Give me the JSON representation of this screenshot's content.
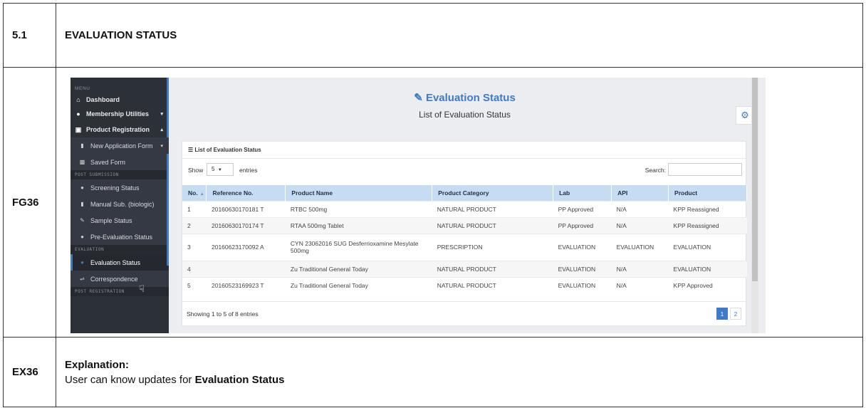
{
  "section": {
    "number": "5.1",
    "title": "EVALUATION STATUS"
  },
  "figure": {
    "label": "FG36"
  },
  "explanation": {
    "label": "EX36",
    "title": "Explanation:",
    "text_prefix": "User can know updates for ",
    "text_bold": "Evaluation Status"
  },
  "sidebar": {
    "menu_label": "MENU",
    "dashboard": "Dashboard",
    "membership": "Membership Utilities",
    "product_registration": "Product Registration",
    "new_application": "New Application Form",
    "saved_form": "Saved Form",
    "post_submission_label": "POST SUBMISSION",
    "screening": "Screening Status",
    "manual_sub": "Manual Sub. (biologic)",
    "sample": "Sample Status",
    "pre_evaluation": "Pre-Evaluation Status",
    "evaluation_label": "EVALUATION",
    "evaluation_status": "Evaluation Status",
    "correspondence": "Correspondence",
    "post_registration_label": "POST REGISTRATION"
  },
  "page": {
    "title": "Evaluation Status",
    "subtitle": "List of Evaluation Status"
  },
  "panel": {
    "heading": "List of Evaluation Status",
    "show_label": "Show",
    "entries_value": "5",
    "entries_label": "entries",
    "search_label": "Search:",
    "columns": [
      "No.",
      "Reference No.",
      "Product Name",
      "Product Category",
      "Lab",
      "API",
      "Product"
    ],
    "rows": [
      [
        "1",
        "20160630170181 T",
        "RTBC 500mg",
        "NATURAL PRODUCT",
        "PP Approved",
        "N/A",
        "KPP Reassigned"
      ],
      [
        "2",
        "20160630170174 T",
        "RTAA 500mg Tablet",
        "NATURAL PRODUCT",
        "PP Approved",
        "N/A",
        "KPP Reassigned"
      ],
      [
        "3",
        "20160623170092 A",
        "CYN 23062016 SUG Desferrioxamine Mesylate 500mg",
        "PRESCRIPTION",
        "EVALUATION",
        "EVALUATION",
        "EVALUATION"
      ],
      [
        "4",
        "",
        "Zu Traditional General Today",
        "NATURAL PRODUCT",
        "EVALUATION",
        "N/A",
        "EVALUATION"
      ],
      [
        "5",
        "20160523169923 T",
        "Zu Traditional General Today",
        "NATURAL PRODUCT",
        "EVALUATION",
        "N/A",
        "KPP Approved"
      ]
    ],
    "footer_info": "Showing 1 to 5 of 8 entries",
    "pages": [
      "1",
      "2"
    ]
  }
}
